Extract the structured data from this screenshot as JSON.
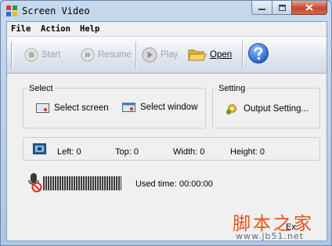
{
  "window": {
    "title": "Screen Video"
  },
  "menu": {
    "items": [
      "File",
      "Action",
      "Help"
    ]
  },
  "toolbar": {
    "start": "Start",
    "resume": "Resume",
    "play": "Play",
    "open": "Open"
  },
  "select_group": {
    "title": "Select",
    "screen": "Select screen",
    "window": "Select window"
  },
  "setting_group": {
    "title": "Setting",
    "output": "Output Setting..."
  },
  "region": {
    "left_label": "Left:",
    "left_value": "0",
    "top_label": "Top:",
    "top_value": "0",
    "width_label": "Width:",
    "width_value": "0",
    "height_label": "Height:",
    "height_value": "0"
  },
  "status": {
    "used_time_label": "Used time:",
    "used_time_value": "00:00:00"
  },
  "footer": {
    "exit_label": "Ex"
  },
  "watermark": {
    "line1": "脚本之家",
    "line2": "www.jb51.net"
  },
  "colors": {
    "accent": "#3a76c4",
    "watermark": "#e9521a"
  },
  "icons": [
    "app-icon",
    "record-icon",
    "resume-icon",
    "play-icon",
    "folder-open-icon",
    "help-icon",
    "screen-icon",
    "window-icon",
    "gear-icon",
    "region-icon",
    "microphone-muted-icon"
  ]
}
